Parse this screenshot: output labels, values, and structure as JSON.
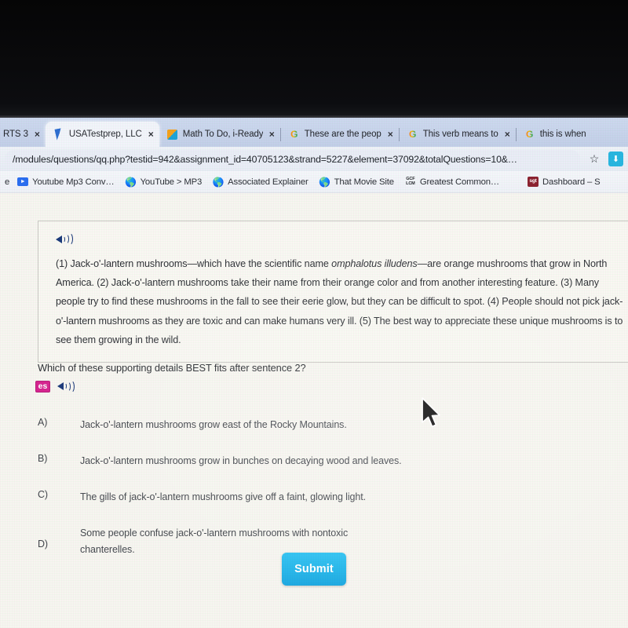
{
  "browser": {
    "tabs": [
      {
        "title": "RTS 3",
        "favicon": "none",
        "active": false,
        "partial": true
      },
      {
        "title": "USATestprep, LLC",
        "favicon": "cursor-icon",
        "active": true,
        "partial": false
      },
      {
        "title": "Math To Do, i-Ready",
        "favicon": "box-icon",
        "active": false,
        "partial": false
      },
      {
        "title": "These are the peop",
        "favicon": "google-icon",
        "active": false,
        "partial": false
      },
      {
        "title": "This verb means to",
        "favicon": "google-icon",
        "active": false,
        "partial": false
      },
      {
        "title": "this is when",
        "favicon": "google-icon",
        "active": false,
        "partial": true
      }
    ],
    "close_label": "×",
    "url": "/modules/questions/qq.php?testid=942&assignment_id=40705123&strand=5227&element=37092&totalQuestions=10&…",
    "star_icon": "☆",
    "extension_icon": "⬇",
    "bookmarks": [
      {
        "label": "e",
        "favicon": "none"
      },
      {
        "label": "Youtube Mp3 Conv…",
        "favicon": "youtube-icon"
      },
      {
        "label": "YouTube > MP3",
        "favicon": "globe-icon"
      },
      {
        "label": "Associated Explainer",
        "favicon": "globe-icon"
      },
      {
        "label": "That Movie Site",
        "favicon": "globe-icon"
      },
      {
        "label": "Greatest Common…",
        "favicon": "gcf-lcm-icon"
      },
      {
        "label": "Dashboard – S",
        "favicon": "red-square-icon"
      }
    ]
  },
  "page": {
    "passage": {
      "speaker_icon": "speaker-icon",
      "part1": "(1) Jack-o'-lantern mushrooms—which have the scientific name ",
      "italic": "omphalotus illudens",
      "part2": "—are orange mushrooms that grow in North America. (2) Jack-o'-lantern mushrooms take their name from their orange color and from another interesting feature. (3) Many people try to find these mushrooms in the fall to see their eerie glow, but they can be difficult to spot. (4) People should not pick jack-o'-lantern mushrooms as they are toxic and can make humans very ill. (5) The best way to appreciate these unique mushrooms is to see them growing in the wild."
    },
    "question_text": "Which of these supporting details BEST fits after sentence 2?",
    "spanish_badge": "es",
    "question_speaker_icon": "speaker-icon",
    "options": [
      {
        "letter": "A)",
        "text": "Jack-o'-lantern mushrooms grow east of the Rocky Mountains."
      },
      {
        "letter": "B)",
        "text": "Jack-o'-lantern mushrooms grow in bunches on decaying wood and leaves."
      },
      {
        "letter": "C)",
        "text": "The gills of jack-o'-lantern mushrooms give off a faint, glowing light."
      },
      {
        "letter": "D)",
        "text": "Some people confuse jack-o'-lantern mushrooms with nontoxic chanterelles."
      }
    ],
    "submit_label": "Submit"
  },
  "colors": {
    "submit_bg": "#1fb4ea",
    "page_bg": "#f6f5f0",
    "speaker": "#1b3a7a",
    "es_badge": "#d6238f",
    "tab_strip": "#c7d4ec"
  }
}
